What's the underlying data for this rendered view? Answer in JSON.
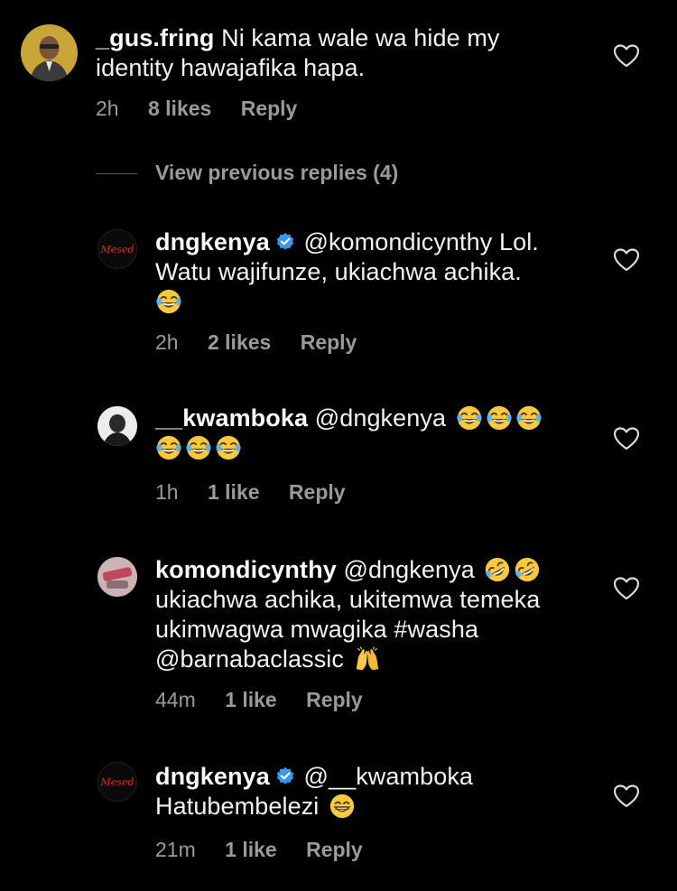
{
  "comments": [
    {
      "username": "_gus.fring",
      "verified": false,
      "text": "Ni kama wale wa hide my identity hawajafika hapa.",
      "time": "2h",
      "likes": "8 likes",
      "reply": "Reply"
    },
    {
      "username": "dngkenya",
      "verified": true,
      "mention": "@komondicynthy",
      "text": "Lol. Watu wajifunze, ukiachwa achika.",
      "emojis": [
        "joy-emoji"
      ],
      "time": "2h",
      "likes": "2 likes",
      "reply": "Reply"
    },
    {
      "username": "__kwamboka",
      "verified": false,
      "mention": "@dngkenya",
      "text": "",
      "emojis": [
        "joy-emoji",
        "joy-emoji",
        "joy-emoji",
        "joy-emoji",
        "joy-emoji",
        "joy-emoji"
      ],
      "time": "1h",
      "likes": "1 like",
      "reply": "Reply"
    },
    {
      "username": "komondicynthy",
      "verified": false,
      "mention": "@dngkenya",
      "line2": "ukiachwa achika, ukitemwa temeka",
      "line3": "ukimwagwa mwagika #washa",
      "line4": "@barnabaclassic",
      "emojis": [
        "rofl-emoji",
        "rofl-emoji",
        "raised-hands-emoji"
      ],
      "time": "44m",
      "likes": "1 like",
      "reply": "Reply"
    },
    {
      "username": "dngkenya",
      "verified": true,
      "mention": "@__kwamboka",
      "text": "Hatubembelezi",
      "emojis": [
        "grin-emoji"
      ],
      "time": "21m",
      "likes": "1 like",
      "reply": "Reply"
    }
  ],
  "view_previous_replies": "View previous replies (4)",
  "colors": {
    "background": "#000000",
    "text": "#f2f2f2",
    "secondary": "#9a9a9a",
    "verified": "#3897f0"
  }
}
